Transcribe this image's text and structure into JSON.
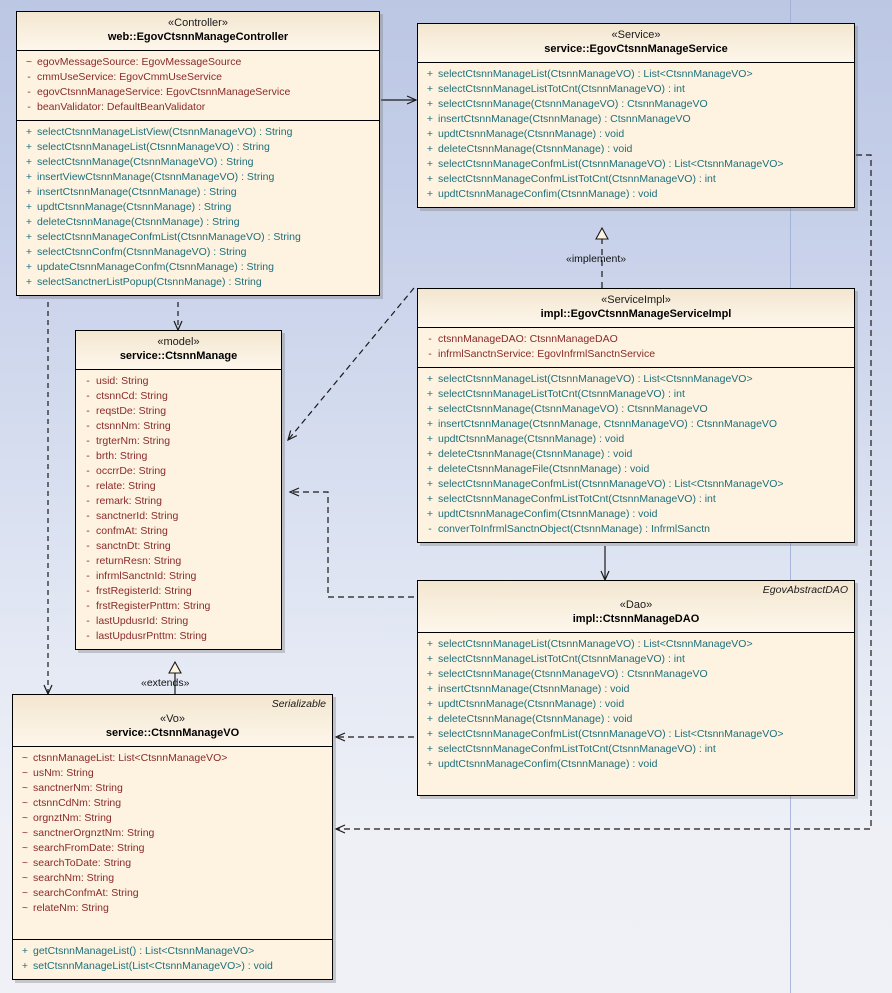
{
  "diagram": {
    "title": "EgovCtsnnManage UML class diagram",
    "background_top": "#bcc7e4",
    "background_bottom": "#f0f1f7",
    "class_fill": "#fdf3e0",
    "attribute_color": "#8a2a2a",
    "method_color": "#1f6f7a"
  },
  "classes": {
    "controller": {
      "stereotype": "«Controller»",
      "name": "web::EgovCtsnnManageController",
      "attributes": [
        {
          "visibility": "~",
          "text": "egovMessageSource:  EgovMessageSource"
        },
        {
          "visibility": "-",
          "text": "cmmUseService:  EgovCmmUseService"
        },
        {
          "visibility": "-",
          "text": "egovCtsnnManageService:  EgovCtsnnManageService"
        },
        {
          "visibility": "-",
          "text": "beanValidator:  DefaultBeanValidator"
        }
      ],
      "methods": [
        {
          "visibility": "+",
          "text": "selectCtsnnManageListView(CtsnnManageVO) : String"
        },
        {
          "visibility": "+",
          "text": "selectCtsnnManageList(CtsnnManageVO) : String"
        },
        {
          "visibility": "+",
          "text": "selectCtsnnManage(CtsnnManageVO) : String"
        },
        {
          "visibility": "+",
          "text": "insertViewCtsnnManage(CtsnnManageVO) : String"
        },
        {
          "visibility": "+",
          "text": "insertCtsnnManage(CtsnnManage) : String"
        },
        {
          "visibility": "+",
          "text": "updtCtsnnManage(CtsnnManage) : String"
        },
        {
          "visibility": "+",
          "text": "deleteCtsnnManage(CtsnnManage) : String"
        },
        {
          "visibility": "+",
          "text": "selectCtsnnManageConfmList(CtsnnManageVO) : String"
        },
        {
          "visibility": "+",
          "text": "selectCtsnnConfm(CtsnnManageVO) : String"
        },
        {
          "visibility": "+",
          "text": "updateCtsnnManageConfm(CtsnnManage) : String"
        },
        {
          "visibility": "+",
          "text": "selectSanctnerListPopup(CtsnnManage) : String"
        }
      ]
    },
    "service": {
      "stereotype": "«Service»",
      "name": "service::EgovCtsnnManageService",
      "methods": [
        {
          "visibility": "+",
          "text": "selectCtsnnManageList(CtsnnManageVO) : List<CtsnnManageVO>"
        },
        {
          "visibility": "+",
          "text": "selectCtsnnManageListTotCnt(CtsnnManageVO) : int"
        },
        {
          "visibility": "+",
          "text": "selectCtsnnManage(CtsnnManageVO) : CtsnnManageVO"
        },
        {
          "visibility": "+",
          "text": "insertCtsnnManage(CtsnnManage) : CtsnnManageVO"
        },
        {
          "visibility": "+",
          "text": "updtCtsnnManage(CtsnnManage) : void"
        },
        {
          "visibility": "+",
          "text": "deleteCtsnnManage(CtsnnManage) : void"
        },
        {
          "visibility": "+",
          "text": "selectCtsnnManageConfmList(CtsnnManageVO) : List<CtsnnManageVO>"
        },
        {
          "visibility": "+",
          "text": "selectCtsnnManageConfmListTotCnt(CtsnnManageVO) : int"
        },
        {
          "visibility": "+",
          "text": "updtCtsnnManageConfim(CtsnnManage) : void"
        }
      ]
    },
    "serviceimpl": {
      "stereotype": "«ServiceImpl»",
      "name": "impl::EgovCtsnnManageServiceImpl",
      "attributes": [
        {
          "visibility": "-",
          "text": "ctsnnManageDAO:  CtsnnManageDAO"
        },
        {
          "visibility": "-",
          "text": "infrmlSanctnService:  EgovInfrmlSanctnService"
        }
      ],
      "methods": [
        {
          "visibility": "+",
          "text": "selectCtsnnManageList(CtsnnManageVO) : List<CtsnnManageVO>"
        },
        {
          "visibility": "+",
          "text": "selectCtsnnManageListTotCnt(CtsnnManageVO) : int"
        },
        {
          "visibility": "+",
          "text": "selectCtsnnManage(CtsnnManageVO) : CtsnnManageVO"
        },
        {
          "visibility": "+",
          "text": "insertCtsnnManage(CtsnnManage, CtsnnManageVO) : CtsnnManageVO"
        },
        {
          "visibility": "+",
          "text": "updtCtsnnManage(CtsnnManage) : void"
        },
        {
          "visibility": "+",
          "text": "deleteCtsnnManage(CtsnnManage) : void"
        },
        {
          "visibility": "+",
          "text": "deleteCtsnnManageFile(CtsnnManage) : void"
        },
        {
          "visibility": "+",
          "text": "selectCtsnnManageConfmList(CtsnnManageVO) : List<CtsnnManageVO>"
        },
        {
          "visibility": "+",
          "text": "selectCtsnnManageConfmListTotCnt(CtsnnManageVO) : int"
        },
        {
          "visibility": "+",
          "text": "updtCtsnnManageConfim(CtsnnManage) : void"
        },
        {
          "visibility": "-",
          "text": "converToInfrmlSanctnObject(CtsnnManage) : InfrmlSanctn"
        }
      ]
    },
    "dao": {
      "parent": "EgovAbstractDAO",
      "stereotype": "«Dao»",
      "name": "impl::CtsnnManageDAO",
      "methods": [
        {
          "visibility": "+",
          "text": "selectCtsnnManageList(CtsnnManageVO) : List<CtsnnManageVO>"
        },
        {
          "visibility": "+",
          "text": "selectCtsnnManageListTotCnt(CtsnnManageVO) : int"
        },
        {
          "visibility": "+",
          "text": "selectCtsnnManage(CtsnnManageVO) : CtsnnManageVO"
        },
        {
          "visibility": "+",
          "text": "insertCtsnnManage(CtsnnManage) : void"
        },
        {
          "visibility": "+",
          "text": "updtCtsnnManage(CtsnnManage) : void"
        },
        {
          "visibility": "+",
          "text": "deleteCtsnnManage(CtsnnManage) : void"
        },
        {
          "visibility": "+",
          "text": "selectCtsnnManageConfmList(CtsnnManageVO) : List<CtsnnManageVO>"
        },
        {
          "visibility": "+",
          "text": "selectCtsnnManageConfmListTotCnt(CtsnnManageVO) : int"
        },
        {
          "visibility": "+",
          "text": "updtCtsnnManageConfim(CtsnnManage) : void"
        }
      ]
    },
    "model": {
      "stereotype": "«model»",
      "name": "service::CtsnnManage",
      "attributes": [
        {
          "visibility": "-",
          "text": "usid: String"
        },
        {
          "visibility": "-",
          "text": "ctsnnCd: String"
        },
        {
          "visibility": "-",
          "text": "reqstDe: String"
        },
        {
          "visibility": "-",
          "text": "ctsnnNm: String"
        },
        {
          "visibility": "-",
          "text": "trgterNm: String"
        },
        {
          "visibility": "-",
          "text": "brth: String"
        },
        {
          "visibility": "-",
          "text": "occrrDe: String"
        },
        {
          "visibility": "-",
          "text": "relate: String"
        },
        {
          "visibility": "-",
          "text": "remark: String"
        },
        {
          "visibility": "-",
          "text": "sanctnerId: String"
        },
        {
          "visibility": "-",
          "text": "confmAt: String"
        },
        {
          "visibility": "-",
          "text": "sanctnDt: String"
        },
        {
          "visibility": "-",
          "text": "returnResn: String"
        },
        {
          "visibility": "-",
          "text": "infrmlSanctnId: String"
        },
        {
          "visibility": "-",
          "text": "frstRegisterId: String"
        },
        {
          "visibility": "-",
          "text": "frstRegisterPnttm: String"
        },
        {
          "visibility": "-",
          "text": "lastUpdusrId: String"
        },
        {
          "visibility": "-",
          "text": "lastUpdusrPnttm: String"
        }
      ]
    },
    "vo": {
      "parent": "Serializable",
      "stereotype": "«Vo»",
      "name": "service::CtsnnManageVO",
      "attributes": [
        {
          "visibility": "~",
          "text": "ctsnnManageList:  List<CtsnnManageVO>"
        },
        {
          "visibility": "~",
          "text": "usNm: String"
        },
        {
          "visibility": "~",
          "text": "sanctnerNm: String"
        },
        {
          "visibility": "~",
          "text": "ctsnnCdNm:  String"
        },
        {
          "visibility": "~",
          "text": "orgnztNm: String"
        },
        {
          "visibility": "~",
          "text": "sanctnerOrgnztNm: String"
        },
        {
          "visibility": "~",
          "text": "searchFromDate: String"
        },
        {
          "visibility": "~",
          "text": "searchToDate: String"
        },
        {
          "visibility": "~",
          "text": "searchNm: String"
        },
        {
          "visibility": "~",
          "text": "searchConfmAt:  String"
        },
        {
          "visibility": "~",
          "text": "relateNm: String"
        }
      ],
      "methods": [
        {
          "visibility": "+",
          "text": "getCtsnnManageList() : List<CtsnnManageVO>"
        },
        {
          "visibility": "+",
          "text": "setCtsnnManageList(List<CtsnnManageVO>) : void"
        }
      ]
    }
  },
  "connectors": [
    {
      "id": "implement",
      "label": "«implement»",
      "from": "serviceimpl",
      "to": "service",
      "style": "dashed-hollow-triangle"
    },
    {
      "id": "extends",
      "label": "«extends»",
      "from": "vo",
      "to": "model",
      "style": "solid-hollow-triangle"
    },
    {
      "id": "ctrl-service",
      "label": "",
      "from": "controller",
      "to": "service",
      "style": "solid-arrow"
    },
    {
      "id": "ctrl-model",
      "label": "",
      "from": "controller",
      "to": "model",
      "style": "dashed-arrow"
    },
    {
      "id": "ctrl-vo",
      "label": "",
      "from": "controller",
      "to": "vo",
      "style": "dashed-arrow"
    },
    {
      "id": "impl-model",
      "label": "",
      "from": "serviceimpl",
      "to": "model",
      "style": "dashed-arrow"
    },
    {
      "id": "impl-dao",
      "label": "",
      "from": "serviceimpl",
      "to": "dao",
      "style": "solid-arrow"
    },
    {
      "id": "dao-model",
      "label": "",
      "from": "dao",
      "to": "model",
      "style": "dashed-arrow"
    },
    {
      "id": "dao-vo",
      "label": "",
      "from": "dao",
      "to": "vo",
      "style": "dashed-arrow"
    },
    {
      "id": "service-vo",
      "label": "",
      "from": "service",
      "to": "vo",
      "style": "dashed-arrow"
    }
  ]
}
